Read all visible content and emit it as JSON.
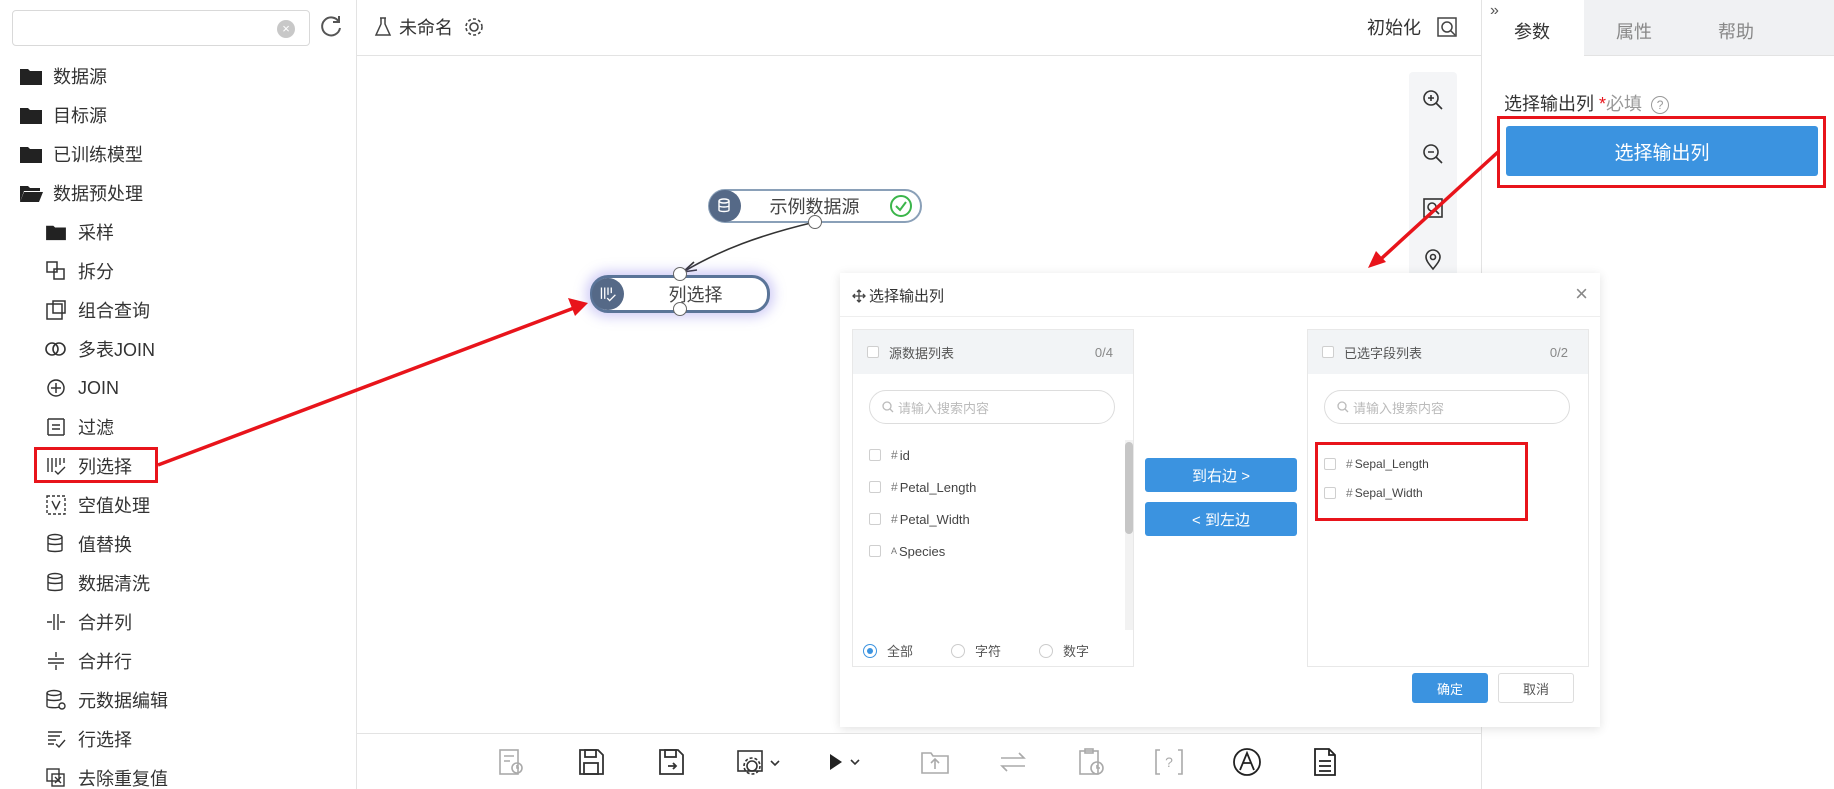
{
  "sidebar": {
    "search": {
      "value": "",
      "placeholder": ""
    },
    "folders": [
      {
        "label": "数据源"
      },
      {
        "label": "目标源"
      },
      {
        "label": "已训练模型"
      },
      {
        "label": "数据预处理"
      }
    ],
    "children": [
      {
        "label": "采样",
        "icon": "folder-icon"
      },
      {
        "label": "拆分",
        "icon": "split-icon"
      },
      {
        "label": "组合查询",
        "icon": "combine-query-icon"
      },
      {
        "label": "多表JOIN",
        "icon": "multi-join-icon"
      },
      {
        "label": "JOIN",
        "icon": "join-icon"
      },
      {
        "label": "过滤",
        "icon": "filter-icon"
      },
      {
        "label": "列选择",
        "icon": "column-select-icon"
      },
      {
        "label": "空值处理",
        "icon": "null-handling-icon"
      },
      {
        "label": "值替换",
        "icon": "value-replace-icon"
      },
      {
        "label": "数据清洗",
        "icon": "data-clean-icon"
      },
      {
        "label": "合并列",
        "icon": "merge-columns-icon"
      },
      {
        "label": "合并行",
        "icon": "merge-rows-icon"
      },
      {
        "label": "元数据编辑",
        "icon": "metadata-edit-icon"
      },
      {
        "label": "行选择",
        "icon": "row-select-icon"
      },
      {
        "label": "去除重复值",
        "icon": "dedupe-icon"
      }
    ]
  },
  "topbar": {
    "title": "未命名",
    "init_label": "初始化"
  },
  "right_panel": {
    "tabs": [
      "参数",
      "属性",
      "帮助"
    ],
    "active_tab": "参数",
    "param_label": "选择输出列",
    "required_star": "*",
    "required_text": "必填",
    "help_glyph": "?",
    "choose_button": "选择输出列"
  },
  "canvas": {
    "nodes": [
      {
        "label": "示例数据源",
        "status": "success"
      },
      {
        "label": "列选择",
        "status": "selected"
      }
    ]
  },
  "dialog": {
    "title": "选择输出列",
    "left": {
      "header": "源数据列表",
      "count": "0/4",
      "search_placeholder": "请输入搜索内容",
      "fields": [
        {
          "type": "#",
          "name": "id"
        },
        {
          "type": "#",
          "name": "Petal_Length"
        },
        {
          "type": "#",
          "name": "Petal_Width"
        },
        {
          "type": "A",
          "name": "Species"
        }
      ],
      "filters": [
        "全部",
        "字符",
        "数字"
      ],
      "active_filter": "全部"
    },
    "right": {
      "header": "已选字段列表",
      "count": "0/2",
      "search_placeholder": "请输入搜索内容",
      "fields": [
        {
          "type": "#",
          "name": "Sepal_Length"
        },
        {
          "type": "#",
          "name": "Sepal_Width"
        }
      ]
    },
    "to_right": "到右边 >",
    "to_left": "< 到左边",
    "ok": "确定",
    "cancel": "取消"
  },
  "colors": {
    "accent": "#3b93e0",
    "highlight": "#e8141b",
    "node_icon": "#556987",
    "success": "#3bb54a"
  }
}
